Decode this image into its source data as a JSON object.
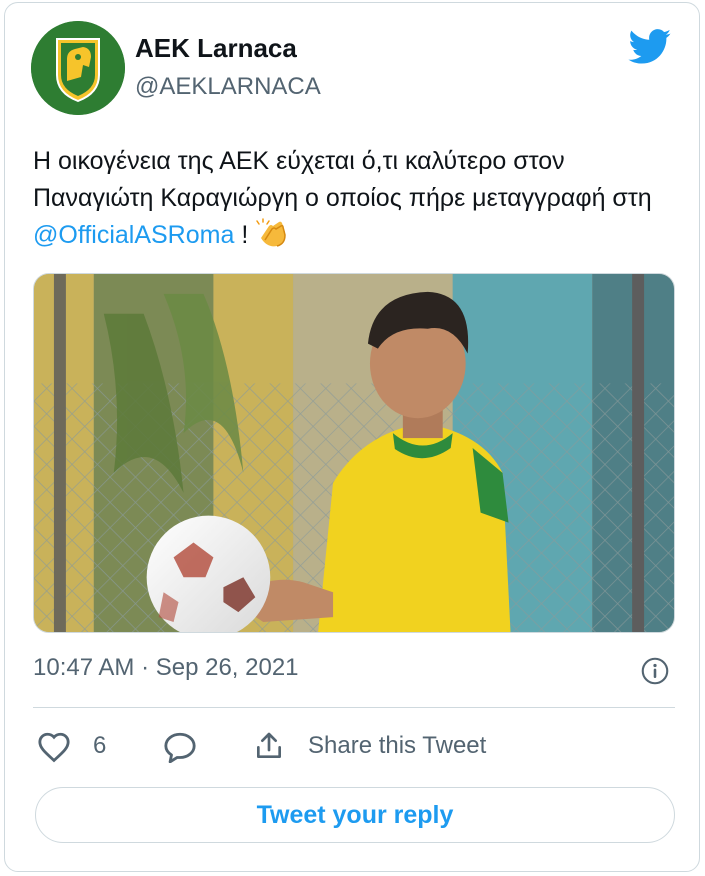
{
  "tweet": {
    "author_name": "AEK Larnaca",
    "author_handle": "@AEKLARNACA",
    "text_before": "Η οικογένεια της ΑΕΚ εύχεται ό,τι καλύτερο στον Παναγιώτη Καραγιώργη ο οποίος πήρε μεταγγραφή στη ",
    "mention": "@OfficialASRoma",
    "text_after": " ! ",
    "timestamp": "10:47 AM · Sep 26, 2021",
    "like_count": "6",
    "share_label": "Share this Tweet",
    "reply_button_label": "Tweet your reply"
  },
  "icons": {
    "brand": "twitter-bird-icon",
    "emoji": "clapping-hands-emoji",
    "info": "info-icon",
    "like": "heart-icon",
    "reply": "reply-bubble-icon",
    "share": "share-upload-icon"
  },
  "colors": {
    "accent": "#1d9bf0",
    "text_primary": "#0f1419",
    "text_secondary": "#536471",
    "border": "#cfd9de",
    "avatar_green": "#2e7d32",
    "avatar_yellow": "#f6c42b"
  }
}
